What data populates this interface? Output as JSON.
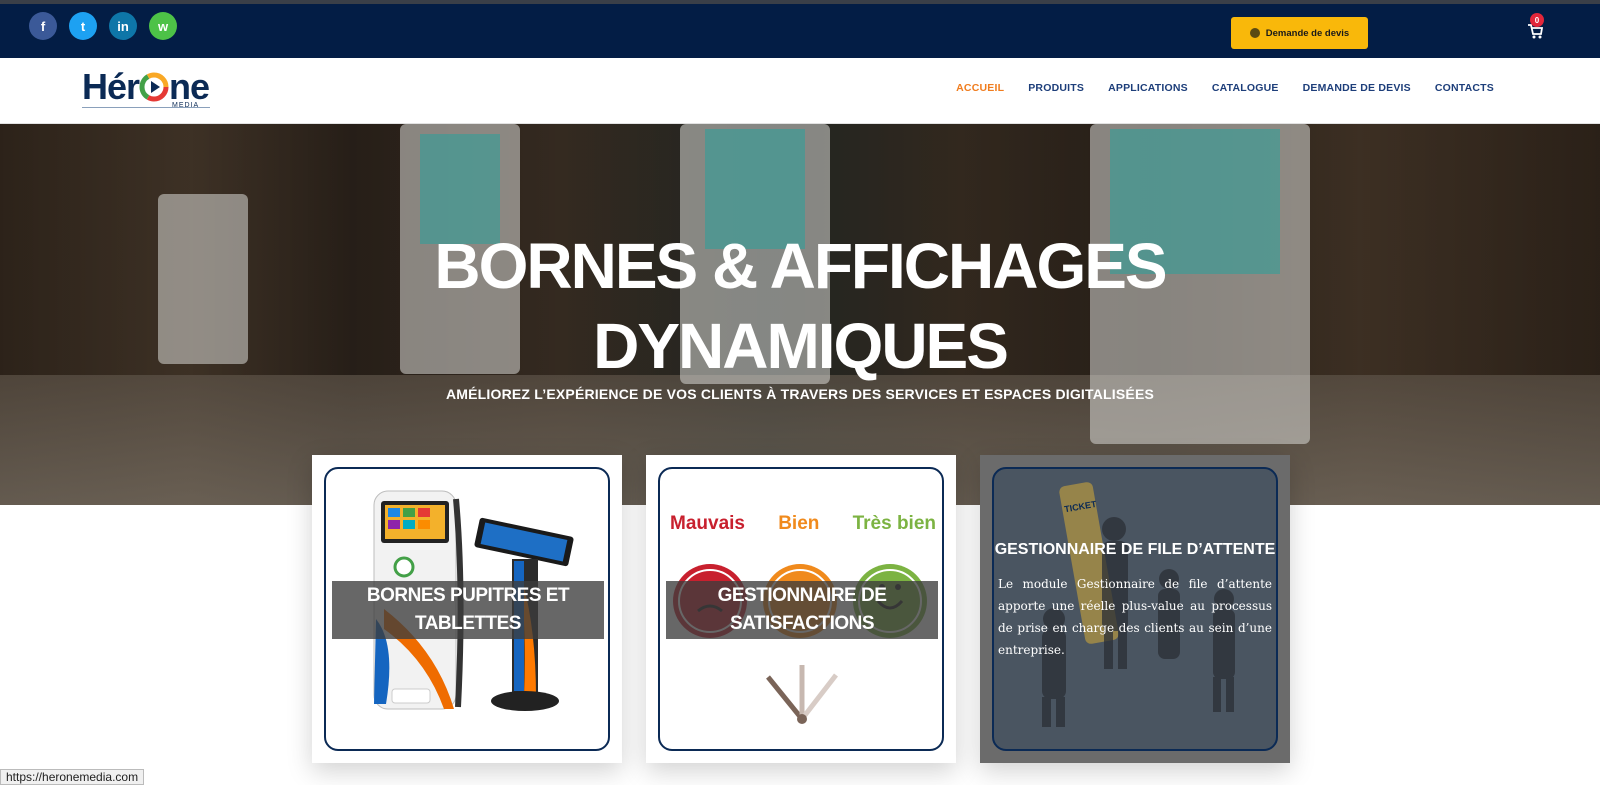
{
  "social": {
    "facebook_icon": "f",
    "twitter_icon": "t",
    "linkedin_icon": "in",
    "whatsapp_icon": "w"
  },
  "header": {
    "quote_button": "Demande de devis",
    "cart_count": "0"
  },
  "logo": {
    "name_part1": "Hér",
    "name_part2": "ne",
    "subtitle": "MEDIA"
  },
  "nav": [
    {
      "label": "ACCUEIL",
      "active": true
    },
    {
      "label": "PRODUITS"
    },
    {
      "label": "APPLICATIONS"
    },
    {
      "label": "CATALOGUE"
    },
    {
      "label": "DEMANDE DE DEVIS"
    },
    {
      "label": "CONTACTS"
    }
  ],
  "hero": {
    "title_line1": "BORNES & AFFICHAGES",
    "title_line2": "DYNAMIQUES",
    "subtitle": "AMÉLIOREZ L’EXPÉRIENCE DE VOS CLIENTS À TRAVERS DES SERVICES ET ESPACES DIGITALISÉES"
  },
  "cards": [
    {
      "title_line1": "BORNES PUPITRES ET",
      "title_line2": "TABLETTES"
    },
    {
      "title_line1": "GESTIONNAIRE DE",
      "title_line2": "SATISFACTIONS",
      "ratings": [
        "Mauvais",
        "Bien",
        "Très bien"
      ],
      "rating_colors": [
        "#c8202e",
        "#f08a1c",
        "#7cb342"
      ]
    },
    {
      "title": "GESTIONNAIRE DE FILE D’ATTENTE",
      "description": "Le module Gestionnaire de file d’attente apporte une réelle plus-value au processus de prise en charge des clients au sein d’une entreprise.",
      "image_sign": "TICKET"
    }
  ],
  "statusbar": {
    "url": "https://heronemedia.com"
  },
  "colors": {
    "topbar": "#031d45",
    "accent": "#f9b80a",
    "nav_active": "#f07c1e",
    "nav": "#1d3e7a"
  }
}
